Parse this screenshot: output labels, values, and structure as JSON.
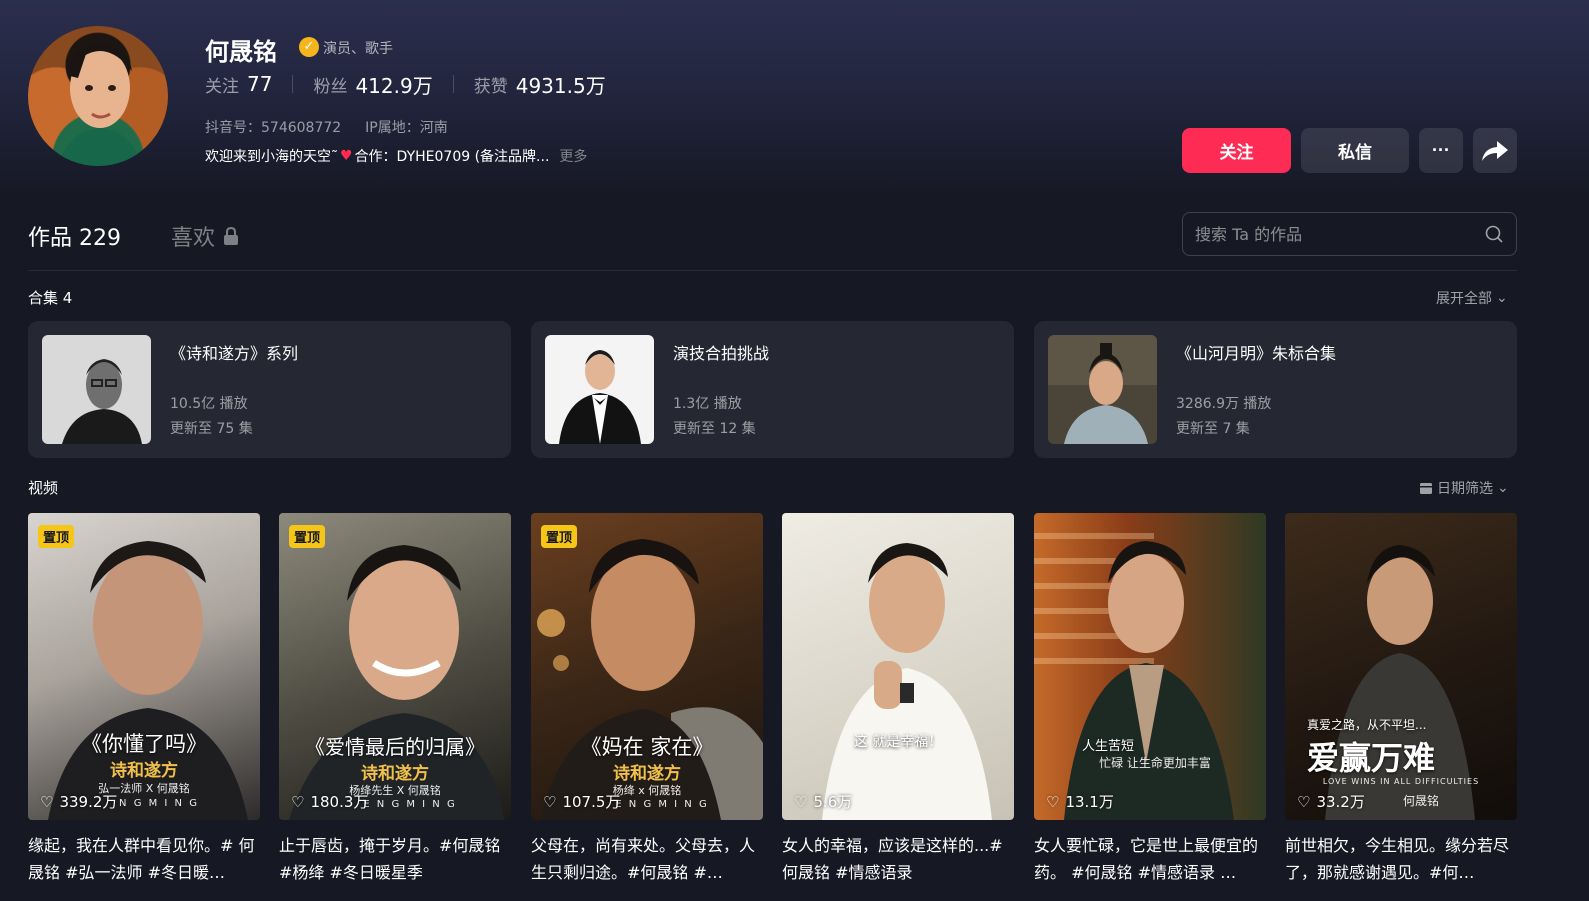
{
  "profile": {
    "name": "何晟铭",
    "verified_icon": "verified-badge-icon",
    "tag": "演员、歌手",
    "stats": [
      {
        "label": "关注",
        "value": "77"
      },
      {
        "label": "粉丝",
        "value": "412.9万"
      },
      {
        "label": "获赞",
        "value": "4931.5万"
      }
    ],
    "douyin_id": "抖音号：574608772",
    "ip": "IP属地：河南",
    "bio_pre": "欢迎来到小海的天空˜",
    "bio_post": "合作：DYHE0709 (备注品牌...",
    "bio_more": "更多"
  },
  "actions": {
    "follow": "关注",
    "message": "私信",
    "more": "···"
  },
  "tabs": {
    "works_label": "作品",
    "works_count": "229",
    "likes_label": "喜欢"
  },
  "search": {
    "placeholder": "搜索 Ta 的作品"
  },
  "collections_section": {
    "title": "合集 4",
    "expand": "展开全部",
    "items": [
      {
        "title": "《诗和遂方》系列",
        "plays": "10.5亿 播放",
        "updated": "更新至 75 集"
      },
      {
        "title": "演技合拍挑战",
        "plays": "1.3亿 播放",
        "updated": "更新至 12 集"
      },
      {
        "title": "《山河月明》朱标合集",
        "plays": "3286.9万 播放",
        "updated": "更新至 7 集"
      }
    ]
  },
  "videos_section": {
    "title": "视频",
    "filter": "日期筛选",
    "pin_label": "置顶",
    "items": [
      {
        "likes": "339.2万",
        "overlay_title": "《你懂了吗》",
        "overlay_sub": "诗和遂方",
        "overlay_small": "弘一法师 X 何晟铭",
        "overlay_tiny": "N G M I N G",
        "caption": "缘起，我在人群中看见你。# 何晟铭 #弘一法师 #冬日暖…"
      },
      {
        "likes": "180.3万",
        "overlay_title": "《爱情最后的归属》",
        "overlay_sub": "诗和遂方",
        "overlay_small": "杨绛先生 X 何晟铭",
        "overlay_tiny": "E N G M I N G",
        "caption": "止于唇齿，掩于岁月。#何晟铭 #杨绛 #冬日暖星季"
      },
      {
        "likes": "107.5万",
        "overlay_title": "《妈在 家在》",
        "overlay_sub": "诗和遂方",
        "overlay_small": "杨绛 x 何晟铭",
        "overlay_tiny": "E N G M I N G",
        "caption": "父母在，尚有来处。父母去，人生只剩归途。#何晟铭 #…"
      },
      {
        "likes": "5.6万",
        "overlay_title": "这 就是幸福！",
        "caption": "女人的幸福，应该是这样的...# 何晟铭 #情感语录"
      },
      {
        "likes": "13.1万",
        "overlay_title": "人生苦短",
        "overlay_small": "忙碌 让生命更加丰富",
        "caption": "女人要忙碌，它是世上最便宜的药。 #何晟铭 #情感语录 …"
      },
      {
        "likes": "33.2万",
        "overlay_pre": "真爱之路，从不平坦...",
        "overlay_title": "爱赢万难",
        "overlay_small": "LOVE WINS IN ALL DIFFICULTIES",
        "overlay_tiny": "何晟铭",
        "caption": "前世相欠，今生相见。缘分若尽了，那就感谢遇见。#何…"
      }
    ]
  }
}
